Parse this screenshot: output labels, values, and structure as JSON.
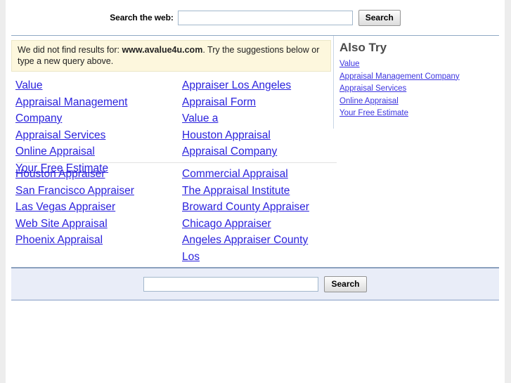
{
  "header": {
    "label": "Search the web:",
    "input_value": "",
    "input_placeholder": "",
    "button_label": "Search"
  },
  "notice": {
    "prefix": "We did not find results for: ",
    "query": "www.avalue4u.com",
    "suffix": ". Try the suggestions below or type a new query above."
  },
  "suggestions": {
    "group1": {
      "left": [
        "Value",
        "Appraisal Management Company",
        "Appraisal Services",
        "Online Appraisal",
        "Your Free Estimate"
      ],
      "right": [
        "Appraiser Los Angeles",
        "Appraisal Form",
        "Value a",
        "Houston Appraisal",
        "Appraisal Company"
      ]
    },
    "group2": {
      "left": [
        "Houston Appraiser",
        "San Francisco Appraiser",
        "Las Vegas Appraiser",
        "Web Site Appraisal",
        "Phoenix Appraisal"
      ],
      "right": [
        "Commercial Appraisal",
        "The Appraisal Institute",
        "Broward County Appraiser",
        "Chicago Appraiser",
        "Angeles Appraiser County Los"
      ]
    }
  },
  "also_try": {
    "title": "Also Try",
    "links": [
      "Value",
      "Appraisal Management Company",
      "Appraisal Services",
      "Online Appraisal",
      "Your Free Estimate"
    ]
  },
  "footer": {
    "input_value": "",
    "input_placeholder": "",
    "button_label": "Search"
  },
  "colors": {
    "link": "#2b22dd",
    "notice_bg": "#fdf7dd",
    "notice_border": "#ece7c8",
    "footer_bg": "#e9edf8",
    "rule": "#8fa9c4",
    "page_bg": "#ffffff",
    "canvas_bg": "#ededed"
  }
}
